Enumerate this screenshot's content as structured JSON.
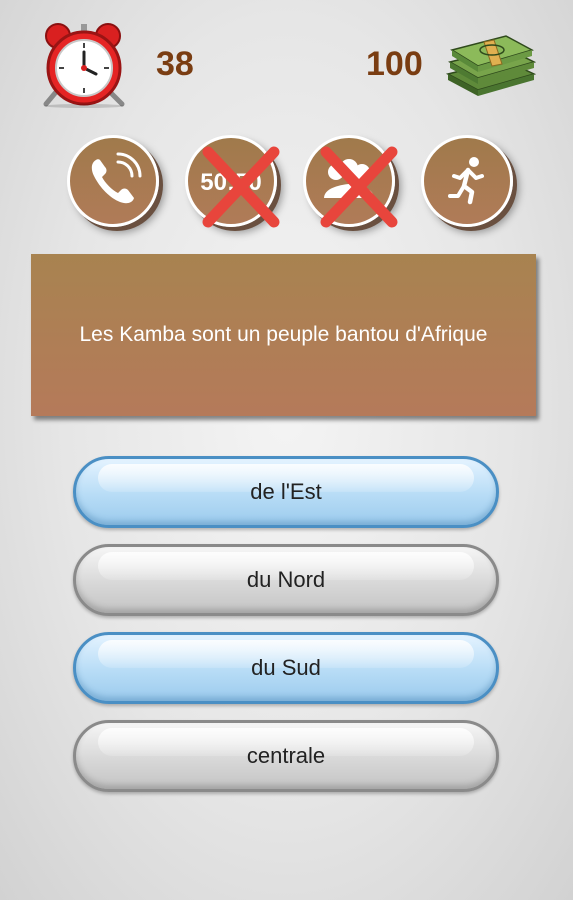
{
  "hud": {
    "timer": "38",
    "score": "100",
    "clock_icon": "alarm-clock-icon",
    "money_icon": "money-stack-icon"
  },
  "lifelines": [
    {
      "name": "phone-a-friend",
      "icon": "phone-icon",
      "used": false
    },
    {
      "name": "fifty-fifty",
      "icon": "fifty-fifty-icon",
      "used": true
    },
    {
      "name": "ask-audience",
      "icon": "audience-icon",
      "used": true
    },
    {
      "name": "quit",
      "icon": "running-man-icon",
      "used": false
    }
  ],
  "question": {
    "text": "Les Kamba sont un peuple bantou d'Afrique"
  },
  "answers": [
    {
      "label": "de l'Est",
      "style": "blue"
    },
    {
      "label": "du Nord",
      "style": "grey"
    },
    {
      "label": "du Sud",
      "style": "blue"
    },
    {
      "label": "centrale",
      "style": "grey"
    }
  ],
  "colors": {
    "accent_brown": "#7a3d12",
    "panel": "#b07b58",
    "cross_red": "#e8453c",
    "answer_blue": "#b7dcf6"
  }
}
